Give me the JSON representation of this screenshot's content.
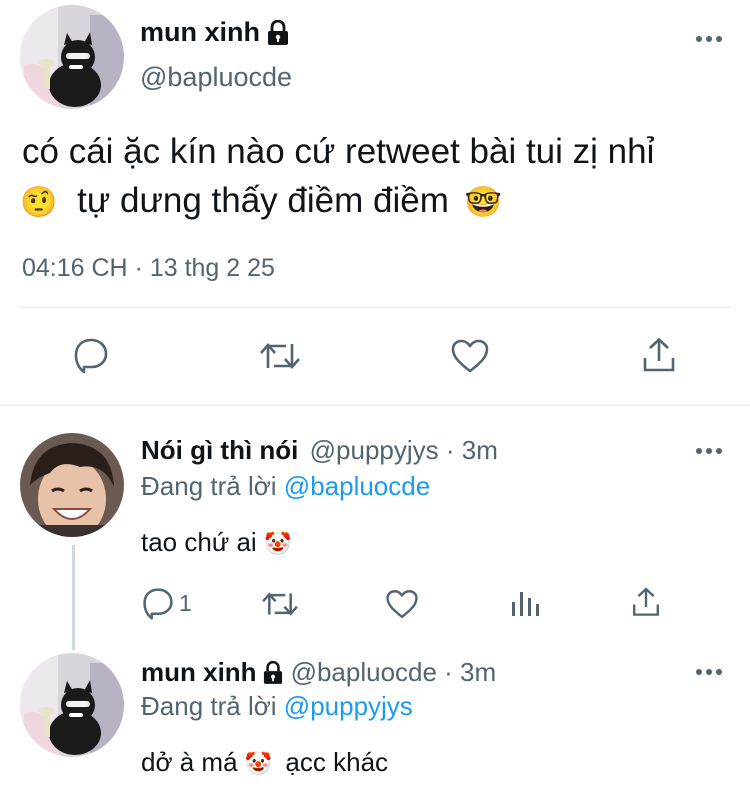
{
  "colors": {
    "text": "#0f1419",
    "muted": "#536471",
    "link": "#1d9bf0",
    "divider": "#e6e9ec"
  },
  "main_tweet": {
    "display_name": "mun xinh",
    "locked_icon": "lock-icon",
    "handle": "@bapluocde",
    "text_line1": "có cái ặc kín nào cứ retweet bài tui zị nhỉ",
    "emoji_1": "🤨",
    "text_line2": "tự dưng thấy điềm điềm",
    "emoji_2": "🤓",
    "timestamp": "04:16 CH · 13 thg 2 25",
    "actions": [
      "reply-icon",
      "retweet-icon",
      "like-icon",
      "share-icon"
    ]
  },
  "reply_1": {
    "display_name": "Nói gì thì nói",
    "handle": "@puppyjys · 3m",
    "replying_prefix": "Đang trả lời",
    "replying_to": "@bapluocde",
    "text": "tao chứ ai",
    "emoji": "🤡",
    "reply_count": "1",
    "actions": [
      "reply-icon",
      "retweet-icon",
      "like-icon",
      "views-icon",
      "share-icon"
    ]
  },
  "reply_2": {
    "display_name": "mun xinh",
    "handle": "@bapluocde · 3m",
    "replying_prefix": "Đang trả lời",
    "replying_to": "@puppyjys",
    "text_before": "dở à má",
    "emoji": "🤡",
    "text_after": "ạcc khác"
  }
}
